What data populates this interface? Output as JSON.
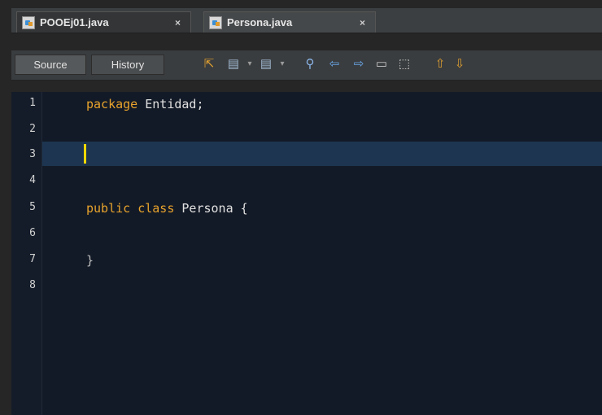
{
  "tabs": [
    {
      "label": "POOEj01.java",
      "close": "×",
      "active": false
    },
    {
      "label": "Persona.java",
      "close": "×",
      "active": true
    }
  ],
  "toolbar": {
    "source_label": "Source",
    "history_label": "History",
    "icons": [
      "last-edit-icon",
      "back-icon",
      "forward-icon",
      "find-icon",
      "find-prev-icon",
      "find-next-icon",
      "toggle-highlight-icon",
      "select-rect-icon",
      "shift-up-icon",
      "shift-down-icon"
    ]
  },
  "editor": {
    "line_numbers": [
      "1",
      "2",
      "3",
      "4",
      "5",
      "6",
      "7",
      "8"
    ],
    "current_line": 3,
    "lines": {
      "l1_kw": "package",
      "l1_rest": " Entidad;",
      "l5_kw1": "public",
      "l5_kw2": "class",
      "l5_rest": " Persona {",
      "l7": "}"
    }
  },
  "colors": {
    "editor_bg": "#131a27",
    "keyword": "#e8a32c",
    "caret": "#ffd700",
    "current_line_bg": "#1d3550"
  }
}
